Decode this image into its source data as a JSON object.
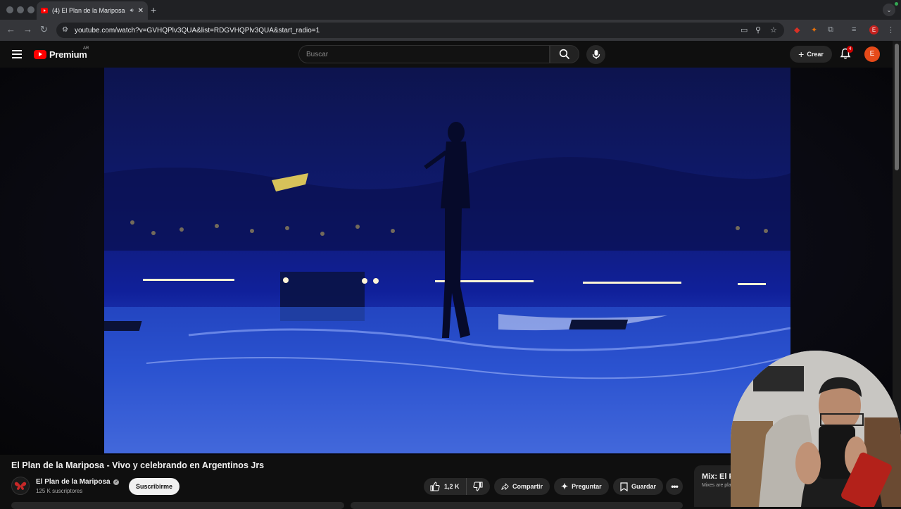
{
  "browser": {
    "tab_title": "(4) El Plan de la Mariposa",
    "url": "youtube.com/watch?v=GVHQPlv3QUA&list=RDGVHQPlv3QUA&start_radio=1",
    "profile_initial": "E"
  },
  "header": {
    "logo_text": "Premium",
    "country_code": "AR",
    "search_placeholder": "Buscar",
    "create_label": "Crear",
    "notification_count": "4",
    "avatar_initial": "E"
  },
  "video": {
    "title": "El Plan de la Mariposa - Vivo y celebrando en Argentinos Jrs",
    "channel_name": "El Plan de la Mariposa",
    "subscribers": "125 K suscriptores",
    "subscribe_label": "Suscribirme",
    "likes": "1,2 K",
    "share_label": "Compartir",
    "ask_label": "Preguntar",
    "save_label": "Guardar"
  },
  "sidebar": {
    "mix_title": "Mix: El Pl",
    "mix_subtitle": "Mixes are playlists"
  },
  "colors": {
    "brand_red": "#ff0000",
    "background": "#0f0f0f",
    "avatar": "#e64a19"
  }
}
